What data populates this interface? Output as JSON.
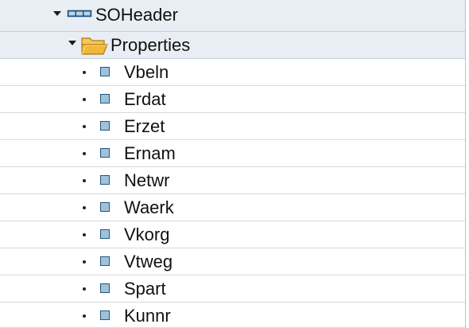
{
  "tree": {
    "root_label": "SOHeader",
    "folder_label": "Properties",
    "properties": [
      {
        "label": "Vbeln"
      },
      {
        "label": "Erdat"
      },
      {
        "label": "Erzet"
      },
      {
        "label": "Ernam"
      },
      {
        "label": "Netwr"
      },
      {
        "label": "Waerk"
      },
      {
        "label": "Vkorg"
      },
      {
        "label": "Vtweg"
      },
      {
        "label": "Spart"
      },
      {
        "label": "Kunnr"
      }
    ],
    "icons": {
      "root": "structure-icon",
      "folder": "open-folder-icon",
      "leaf": "property-icon",
      "expand": "expanded-caret-icon"
    },
    "colors": {
      "header_row": "#e9eef4",
      "folder": "#f2b63a",
      "leaf_fill": "#9fc2db",
      "leaf_border": "#23577e"
    }
  }
}
